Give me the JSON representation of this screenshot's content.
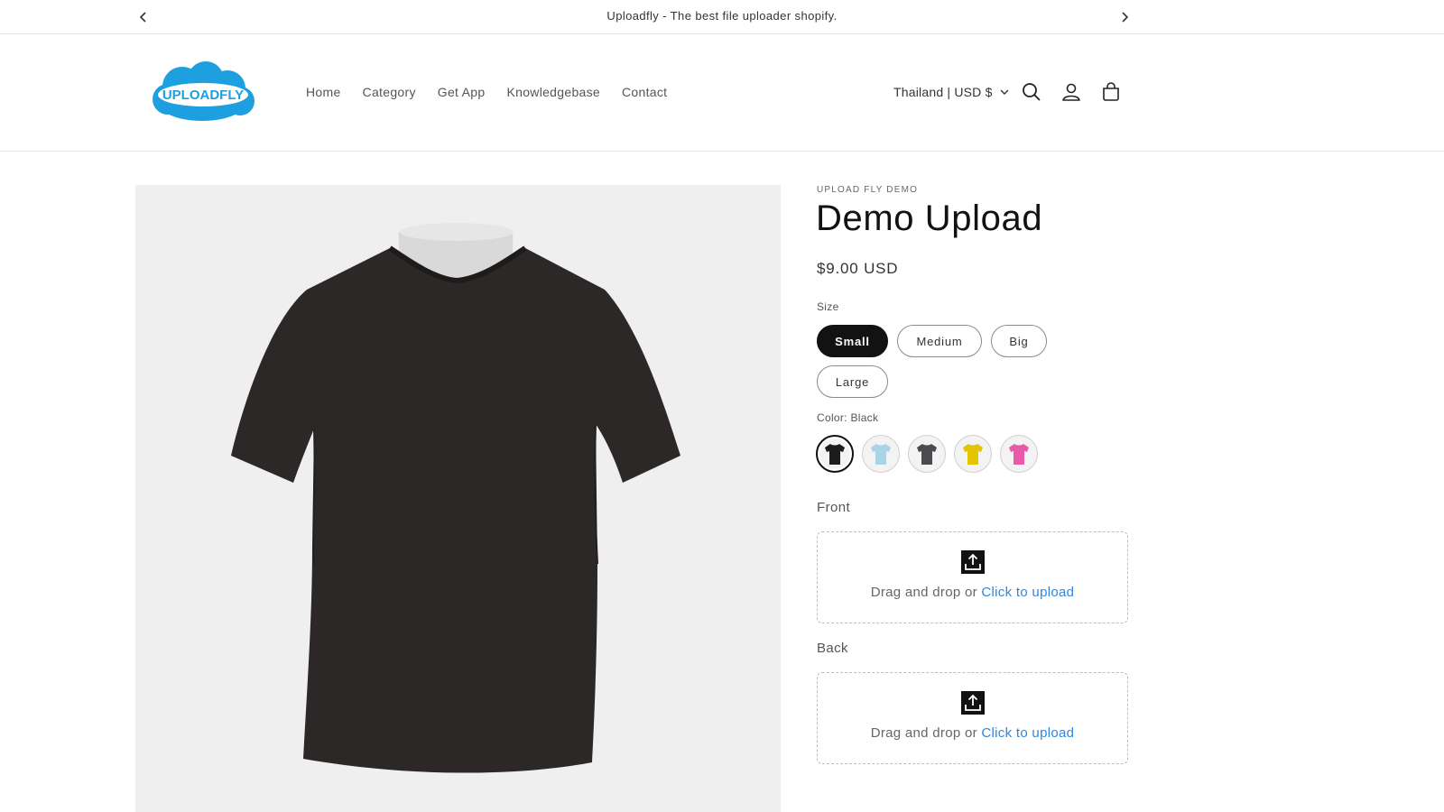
{
  "announcement": {
    "text": "Uploadfly - The best file uploader shopify.",
    "prev_icon": "chevron-left-icon",
    "next_icon": "chevron-right-icon"
  },
  "header": {
    "logo_text": "UPLOADFLY",
    "nav": [
      "Home",
      "Category",
      "Get App",
      "Knowledgebase",
      "Contact"
    ],
    "locale": "Thailand | USD $",
    "icons": [
      "search-icon",
      "account-icon",
      "cart-icon"
    ]
  },
  "product": {
    "vendor": "UPLOAD FLY DEMO",
    "title": "Demo Upload",
    "price": "$9.00 USD",
    "size_label": "Size",
    "sizes": [
      "Small",
      "Medium",
      "Big",
      "Large"
    ],
    "selected_size": "Small",
    "color_label": "Color: Black",
    "swatch_colors": [
      "#1c1c1c",
      "#a9d4e6",
      "#4a4a4f",
      "#e2c400",
      "#e85aaa"
    ],
    "image_color": "#2b2827",
    "uploads": [
      {
        "label": "Front",
        "text": "Drag and drop or ",
        "link": "Click to upload"
      },
      {
        "label": "Back",
        "text": "Drag and drop or ",
        "link": "Click to upload"
      }
    ]
  },
  "colors": {
    "accent_link": "#2f86e0",
    "logo_blue": "#1d9fe0",
    "text_dark": "#121212"
  }
}
